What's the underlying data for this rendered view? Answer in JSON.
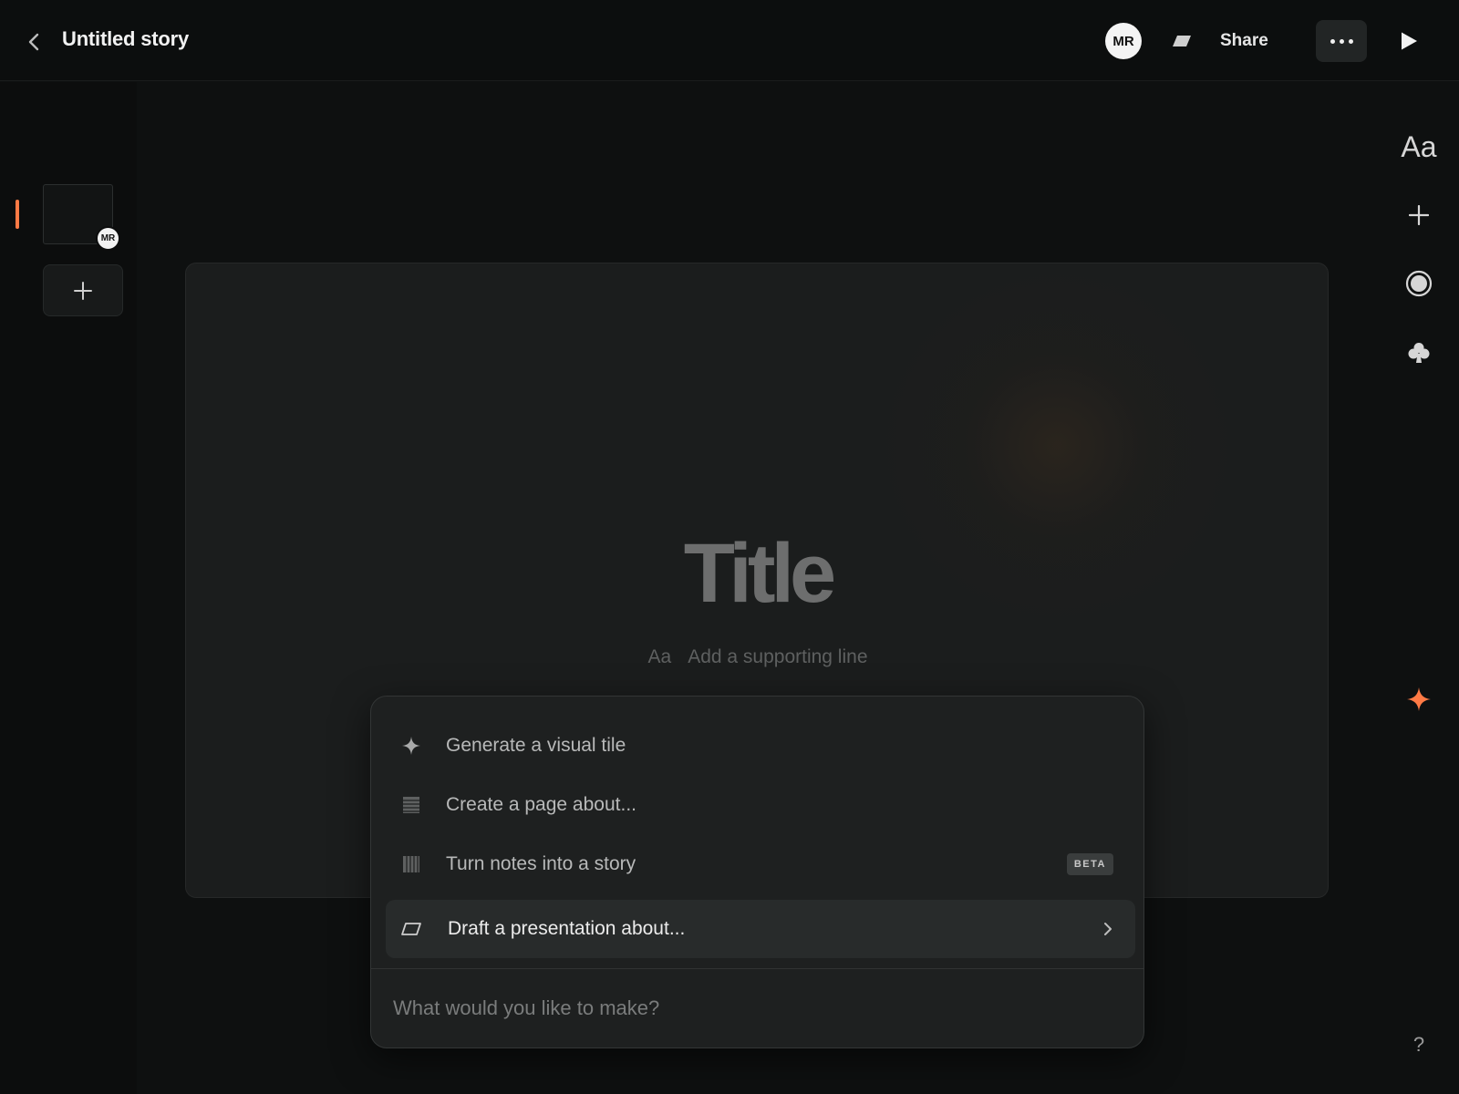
{
  "header": {
    "title": "Untitled story",
    "avatar_initials": "MR",
    "share_label": "Share",
    "back_icon": "chevron-left-icon",
    "present_mode_icon": "parallelogram-icon",
    "more_icon": "ellipsis-icon",
    "play_icon": "play-icon"
  },
  "sidebar": {
    "thumb_avatar_initials": "MR",
    "add_icon": "plus-icon",
    "accent_color": "#ff7a45"
  },
  "canvas": {
    "title_placeholder": "Title",
    "supporting_prefix": "Aa",
    "supporting_placeholder": "Add a supporting line"
  },
  "right_rail": {
    "text_style_label": "Aa",
    "items": [
      "text-style-icon",
      "plus-icon",
      "record-icon",
      "club-icon",
      "sparkle-icon"
    ],
    "help_label": "?",
    "ai_accent": "#ff7a45"
  },
  "ai_menu": {
    "items": [
      {
        "label": "Generate a visual tile",
        "icon": "sparkle-icon"
      },
      {
        "label": "Create a page about...",
        "icon": "page-icon"
      },
      {
        "label": "Turn notes into a story",
        "icon": "notes-icon",
        "badge": "BETA"
      },
      {
        "label": "Draft a presentation about...",
        "icon": "parallelogram-icon",
        "active": true,
        "trailing": "chevron-right-icon"
      }
    ],
    "input_placeholder": "What would you like to make?"
  }
}
